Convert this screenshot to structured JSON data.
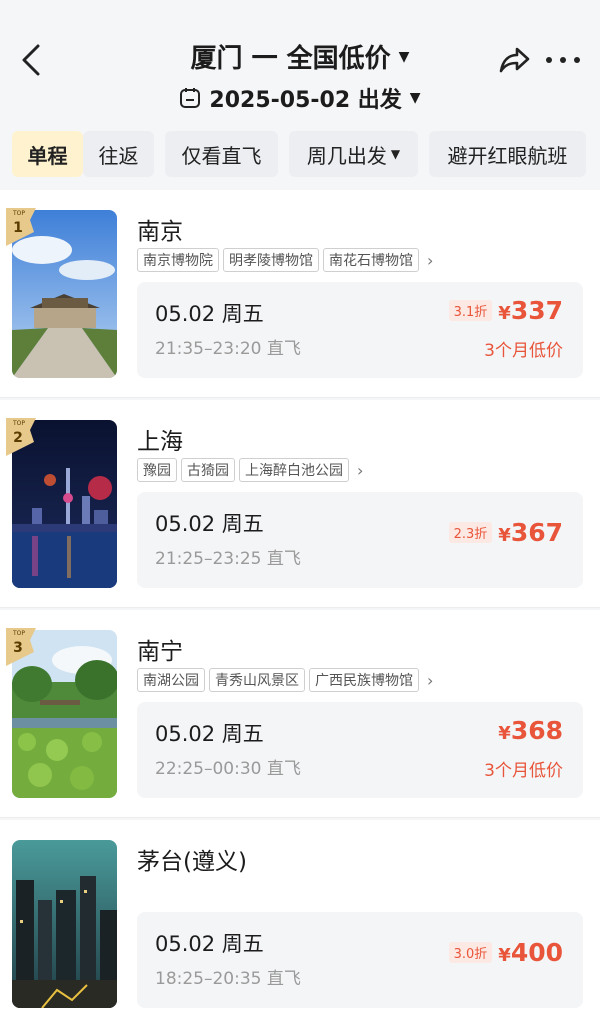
{
  "header": {
    "title": "厦门 一 全国低价",
    "date_text": "2025-05-02 出发"
  },
  "filters": [
    "单程",
    "往返",
    "仅看直飞",
    "周几出发",
    "避开红眼航班"
  ],
  "colors": {
    "accent": "#e8553a",
    "active_chip": "#fff3cf"
  },
  "rank_top_label": "TOP",
  "results": [
    {
      "rank": "1",
      "city": "南京",
      "tags": [
        "南京博物院",
        "明孝陵博物馆",
        "南花石博物馆"
      ],
      "date": "05.02 周五",
      "time": "21:35–23:20 直飞",
      "discount": "3.1折",
      "price": "337",
      "low_label": "3个月低价",
      "image": "city-gate"
    },
    {
      "rank": "2",
      "city": "上海",
      "tags": [
        "豫园",
        "古猗园",
        "上海醉白池公园"
      ],
      "date": "05.02 周五",
      "time": "21:25–23:25 直飞",
      "discount": "2.3折",
      "price": "367",
      "low_label": "",
      "image": "night-skyline"
    },
    {
      "rank": "3",
      "city": "南宁",
      "tags": [
        "南湖公园",
        "青秀山风景区",
        "广西民族博物馆"
      ],
      "date": "05.02 周五",
      "time": "22:25–00:30 直飞",
      "discount": "",
      "price": "368",
      "low_label": "3个月低价",
      "image": "lotus-park"
    },
    {
      "rank": "",
      "city": "茅台(遵义)",
      "tags": [],
      "date": "05.02 周五",
      "time": "18:25–20:35 直飞",
      "discount": "3.0折",
      "price": "400",
      "low_label": "",
      "image": "city-night"
    }
  ]
}
